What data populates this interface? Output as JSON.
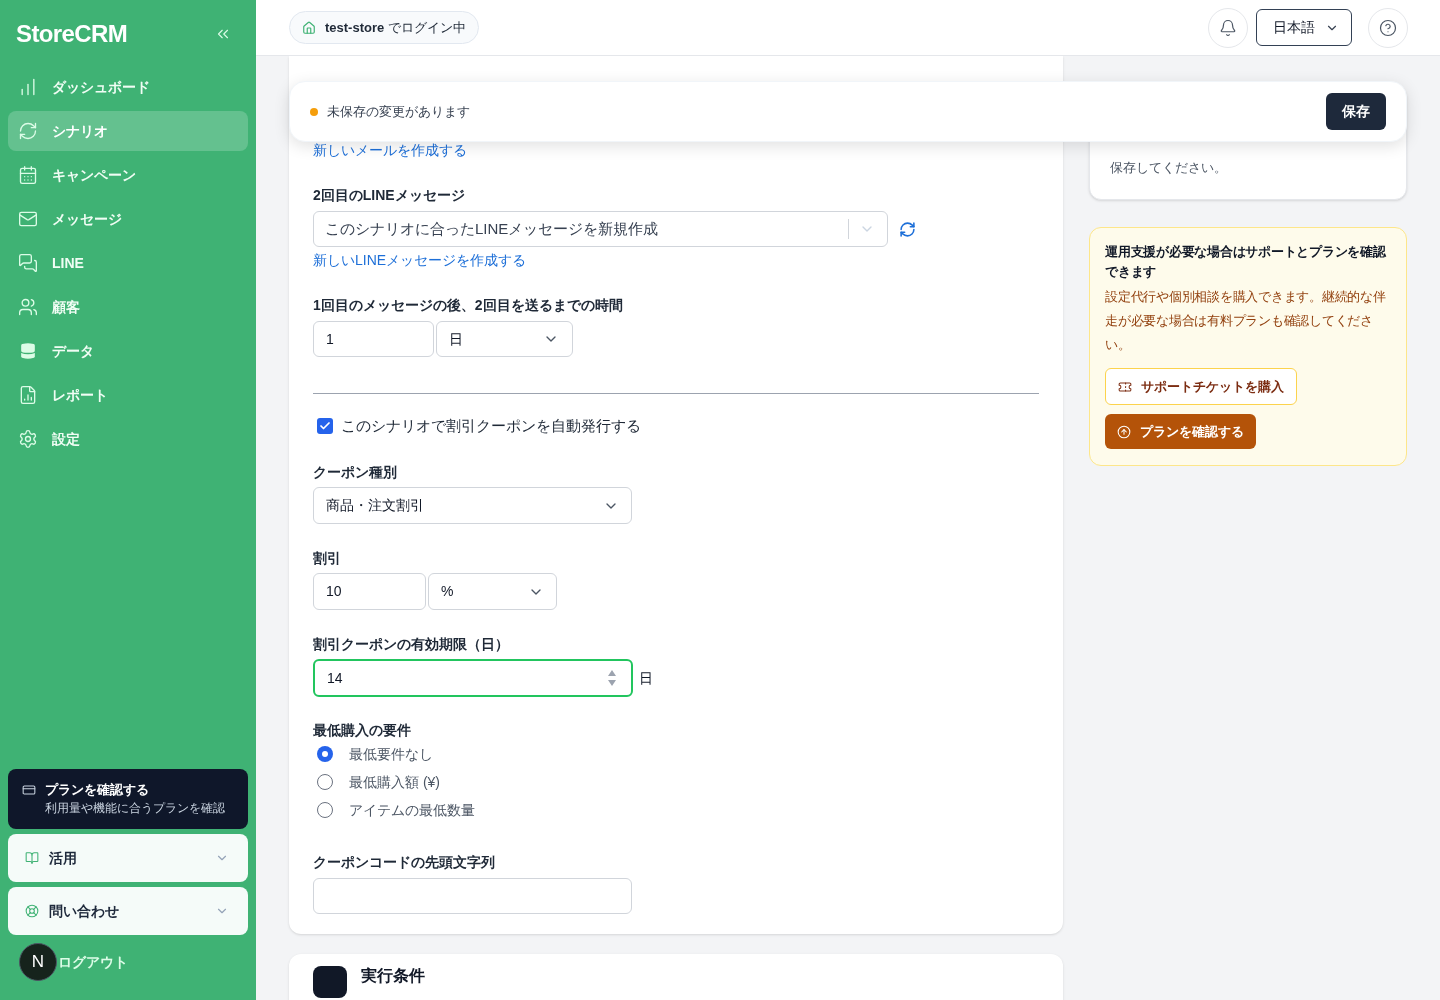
{
  "sidebar": {
    "logo": "StoreCRM",
    "items": [
      {
        "label": "ダッシュボード",
        "selected": false
      },
      {
        "label": "シナリオ",
        "selected": true
      },
      {
        "label": "キャンペーン",
        "selected": false
      },
      {
        "label": "メッセージ",
        "selected": false
      },
      {
        "label": "LINE",
        "selected": false
      },
      {
        "label": "顧客",
        "selected": false
      },
      {
        "label": "データ",
        "selected": false
      },
      {
        "label": "レポート",
        "selected": false
      },
      {
        "label": "設定",
        "selected": false
      }
    ]
  },
  "plan_card": {
    "title": "プランを確認する",
    "subtitle": "利用量や機能に合うプランを確認"
  },
  "accordions": [
    {
      "label": "活用",
      "expanded": false
    },
    {
      "label": "問い合わせ",
      "expanded": false
    }
  ],
  "user": {
    "initial": "N",
    "logout": "ログアウト"
  },
  "topbar": {
    "store_status": "**test-store** でログイン中",
    "language": "日本語"
  },
  "unsaved_banner": {
    "message": "未保存の変更があります",
    "save_button": "保存"
  },
  "form": {
    "top_link": "新しいメールを作成する",
    "line_message": {
      "label": "2回目のLINEメッセージ",
      "value": "このシナリオに合ったLINEメッセージを新規作成",
      "link": "新しいLINEメッセージを作成する"
    },
    "interval": {
      "label": "1回目のメッセージの後、2回目を送るまでの時間",
      "value": "1",
      "unit": "日"
    },
    "coupon_toggle": {
      "label": "このシナリオで割引クーポンを自動発行する",
      "checked": true
    },
    "coupon_type": {
      "label": "クーポン種別",
      "value": "商品・注文割引"
    },
    "discount": {
      "label": "割引",
      "value": "10",
      "unit": "%"
    },
    "expiry": {
      "label": "割引クーポンの有効期限（日）",
      "value": "14",
      "suffix": "日",
      "focused": true
    },
    "minimum": {
      "label": "最低購入の要件",
      "options": [
        {
          "label": "最低要件なし",
          "selected": true
        },
        {
          "label": "最低購入額 (¥)",
          "selected": false
        },
        {
          "label": "アイテムの最低数量",
          "selected": false
        }
      ]
    },
    "code_prefix": {
      "label": "クーポンコードの先頭文字列"
    }
  },
  "next_section": {
    "title": "実行条件"
  },
  "side": {
    "review_note": "保存してください。",
    "support": {
      "title": "運用支援が必要な場合はサポートとプランを確認できます",
      "description": "設定代行や個別相談を購入できます。継続的な伴走が必要な場合は有料プランも確認してください。",
      "buttons": [
        {
          "label": "サポートチケットを購入",
          "kind": "outline"
        },
        {
          "label": "プランを確認する",
          "kind": "primary"
        }
      ]
    }
  }
}
